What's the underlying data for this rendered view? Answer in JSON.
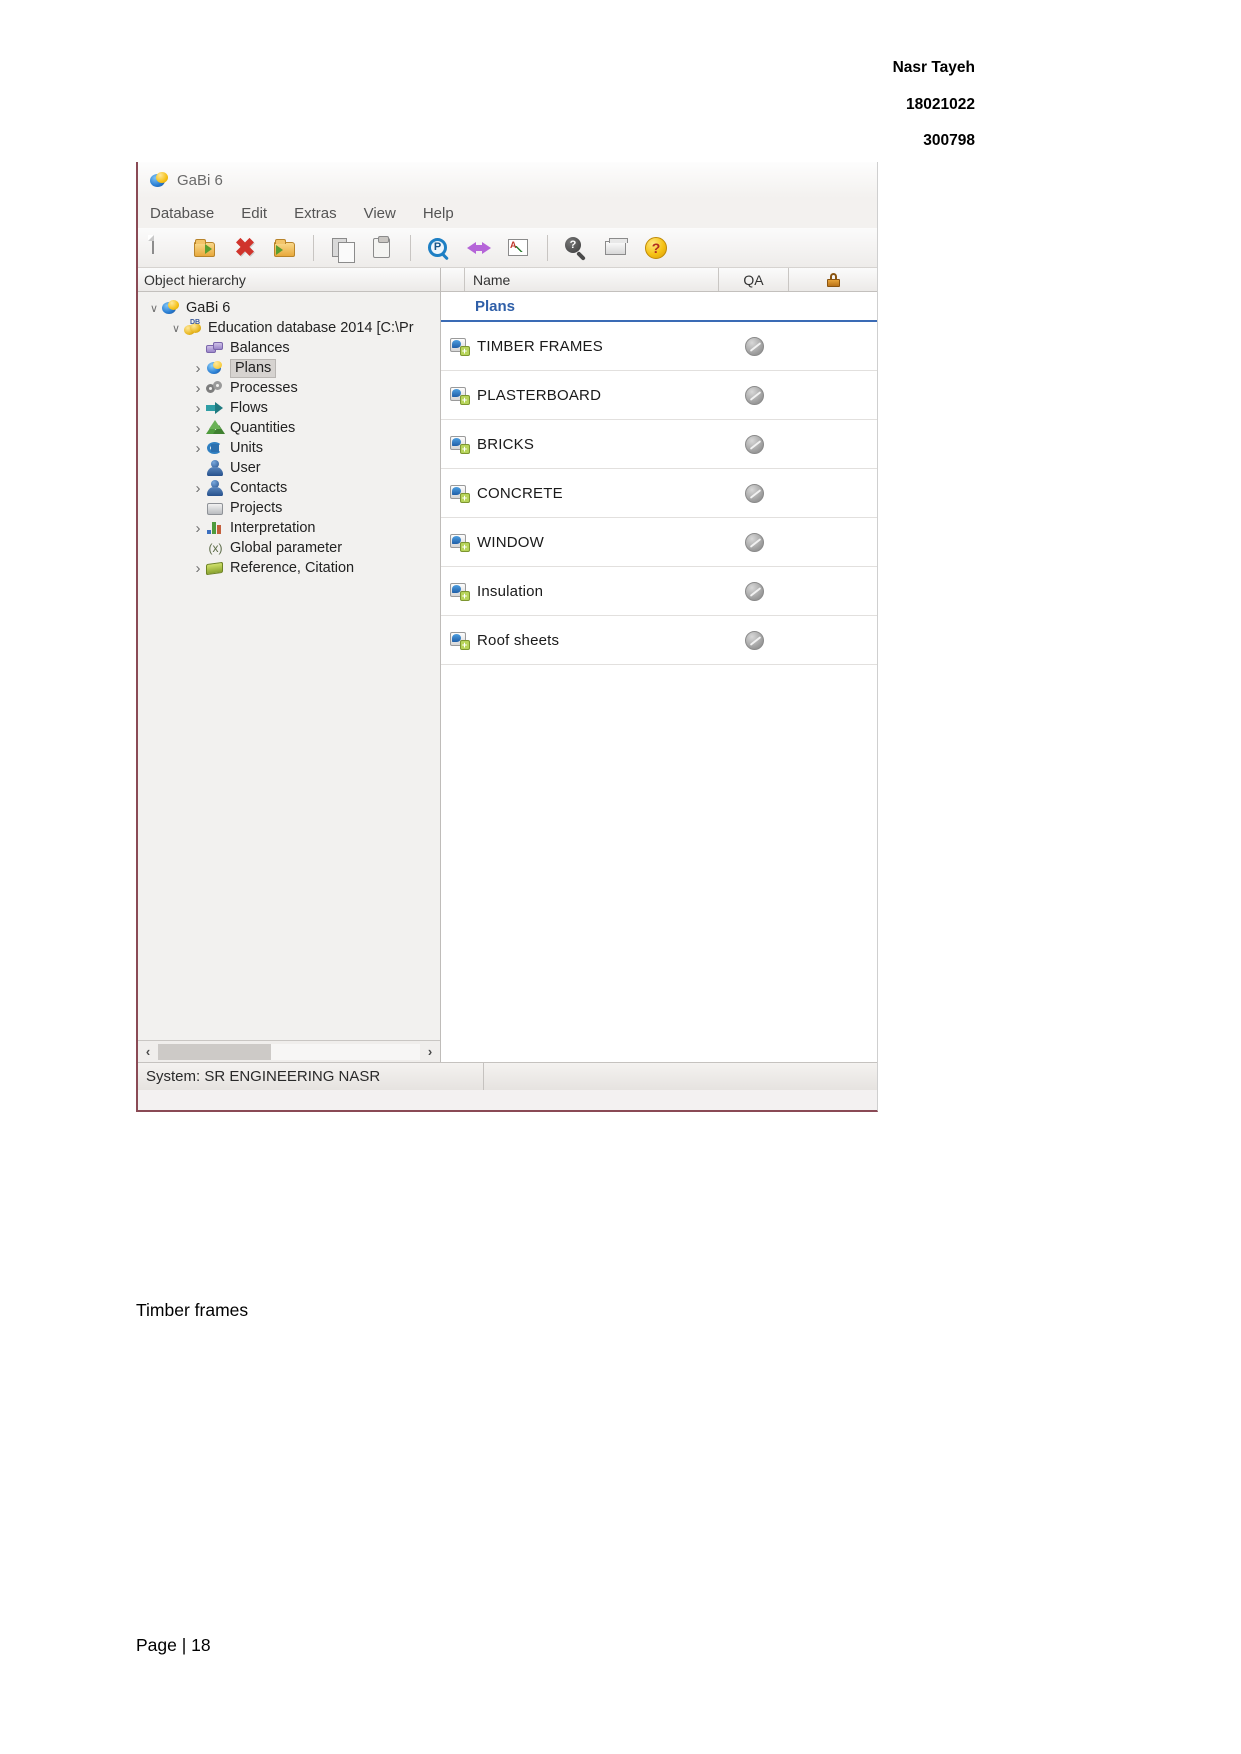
{
  "document": {
    "header_lines": [
      "Nasr Tayeh",
      "18021022",
      "300798"
    ],
    "caption": "Timber frames",
    "page_footer": "Page  |  18"
  },
  "app": {
    "title": "GaBi 6",
    "title_icon": "gabi-globe-icon",
    "menu": [
      {
        "label": "Database"
      },
      {
        "label": "Edit"
      },
      {
        "label": "Extras"
      },
      {
        "label": "View"
      },
      {
        "label": "Help"
      }
    ],
    "toolbar": [
      {
        "name": "new-document-button",
        "icon": "new-document-icon"
      },
      {
        "name": "open-database-button",
        "icon": "open-database-icon"
      },
      {
        "name": "delete-button",
        "icon": "red-x-delete-icon"
      },
      {
        "name": "open-folder-button",
        "icon": "open-folder-icon"
      },
      {
        "name": "copy-button",
        "icon": "copy-pages-icon"
      },
      {
        "name": "paste-button",
        "icon": "clipboard-paste-icon"
      },
      {
        "name": "parameter-search-button",
        "icon": "parameter-magnifier-icon"
      },
      {
        "name": "exchange-button",
        "icon": "double-arrow-exchange-icon"
      },
      {
        "name": "analysis-chart-button",
        "icon": "chart-stack-icon"
      },
      {
        "name": "search-button",
        "icon": "magnifier-question-icon"
      },
      {
        "name": "archive-button",
        "icon": "tray-archive-icon"
      },
      {
        "name": "help-button",
        "icon": "yellow-question-help-icon"
      }
    ]
  },
  "left_pane": {
    "header": "Object hierarchy",
    "tree": [
      {
        "label": "GaBi 6",
        "depth": 0,
        "chev": "down",
        "icon": "globe-icon",
        "selected": false
      },
      {
        "label": "Education database 2014 [C:\\Pr",
        "depth": 1,
        "chev": "down",
        "icon": "database-icon",
        "selected": false
      },
      {
        "label": "Balances",
        "depth": 2,
        "chev": "none",
        "icon": "balances-icon",
        "selected": false
      },
      {
        "label": "Plans",
        "depth": 2,
        "chev": "right",
        "icon": "plans-icon",
        "selected": true
      },
      {
        "label": "Processes",
        "depth": 2,
        "chev": "right",
        "icon": "processes-gear-icon",
        "selected": false
      },
      {
        "label": "Flows",
        "depth": 2,
        "chev": "right",
        "icon": "flows-arrow-icon",
        "selected": false
      },
      {
        "label": "Quantities",
        "depth": 2,
        "chev": "right",
        "icon": "quantities-icon",
        "selected": false
      },
      {
        "label": "Units",
        "depth": 2,
        "chev": "right",
        "icon": "units-icon",
        "selected": false
      },
      {
        "label": "User",
        "depth": 2,
        "chev": "none",
        "icon": "user-icon",
        "selected": false
      },
      {
        "label": "Contacts",
        "depth": 2,
        "chev": "right",
        "icon": "contacts-icon",
        "selected": false
      },
      {
        "label": "Projects",
        "depth": 2,
        "chev": "none",
        "icon": "projects-icon",
        "selected": false
      },
      {
        "label": "Interpretation",
        "depth": 2,
        "chev": "right",
        "icon": "interpretation-bars-icon",
        "selected": false
      },
      {
        "label": "Global parameter",
        "depth": 2,
        "chev": "none",
        "icon": "global-parameter-icon",
        "icon_text": "(x)",
        "selected": false
      },
      {
        "label": "Reference, Citation",
        "depth": 2,
        "chev": "right",
        "icon": "reference-book-icon",
        "selected": false
      }
    ],
    "scrollbar": {
      "left_arrow": "‹",
      "right_arrow": "›"
    }
  },
  "right_pane": {
    "columns": {
      "name": "Name",
      "qa": "QA",
      "lock_icon": "lock-icon"
    },
    "group_title": "Plans",
    "rows": [
      {
        "name": "TIMBER FRAMES",
        "icon": "plan-item-icon",
        "qa": "qa-disc-icon"
      },
      {
        "name": "PLASTERBOARD",
        "icon": "plan-item-icon",
        "qa": "qa-disc-icon"
      },
      {
        "name": "BRICKS",
        "icon": "plan-item-icon",
        "qa": "qa-disc-icon"
      },
      {
        "name": "CONCRETE",
        "icon": "plan-item-icon",
        "qa": "qa-disc-icon"
      },
      {
        "name": "WINDOW",
        "icon": "plan-item-icon",
        "qa": "qa-disc-icon"
      },
      {
        "name": "Insulation",
        "icon": "plan-item-icon",
        "qa": "qa-disc-icon"
      },
      {
        "name": "Roof sheets",
        "icon": "plan-item-icon",
        "qa": "qa-disc-icon"
      }
    ]
  },
  "statusbar": {
    "system_text": "System: SR ENGINEERING NASR"
  },
  "colors": {
    "group_title": "#2f5fa8",
    "window_chrome": "#f3f1ef",
    "accent_border": "#8a4a55"
  }
}
